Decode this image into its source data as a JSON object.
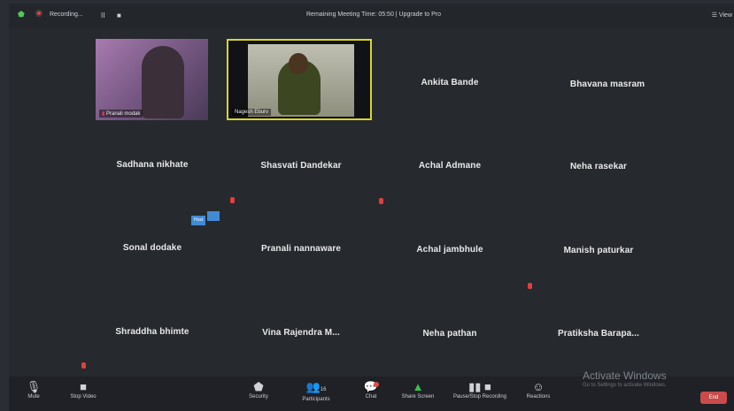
{
  "topbar": {
    "recording": "Recording...",
    "pause": "II",
    "stop": "■",
    "timer": "Remaining Meeting Time: 05:50 | Upgrade to Pro",
    "view": "View"
  },
  "videos": [
    {
      "name": "Pranali modak"
    },
    {
      "name": "Nagesh Eburv"
    }
  ],
  "participants": [
    "Ankita Bande",
    "Bhavana masram",
    "Sadhana nikhate",
    "Shasvati Dandekar",
    "Achal Admane",
    "Neha rasekar",
    "Sonal dodake",
    "Pranali nannaware",
    "Achal jambhule",
    "Manish paturkar",
    "Shraddha bhimte",
    "Vina Rajendra M...",
    "Neha pathan",
    "Pratiksha Barapa..."
  ],
  "chips": {
    "left": "Host",
    "right": ""
  },
  "toolbar": {
    "mute": "Mute",
    "stop_video": "Stop Video",
    "security": "Security",
    "participants": "Participants",
    "participants_count": "16",
    "chat": "Chat",
    "share": "Share Screen",
    "record": "Pause/Stop Recording",
    "reactions": "Reactions",
    "end": "End"
  },
  "watermark": {
    "title": "Activate Windows",
    "sub": "Go to Settings to activate Windows."
  },
  "colors": {
    "accent_green": "#3bc24a",
    "speaker_border": "#d8d62a",
    "end_red": "#c94b4b"
  }
}
